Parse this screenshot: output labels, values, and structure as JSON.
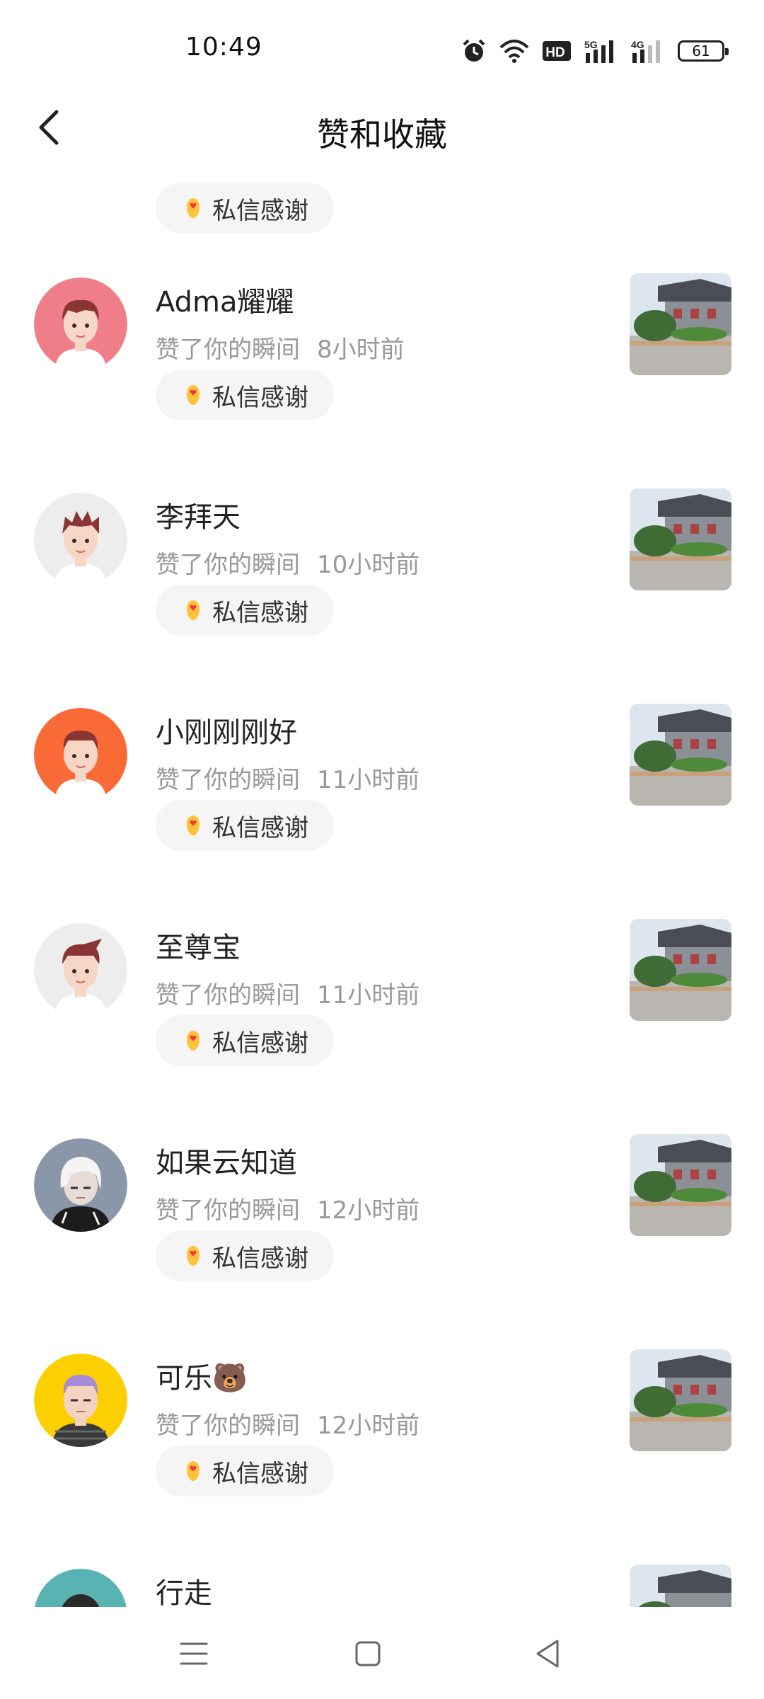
{
  "status_bar": {
    "time": "10:49",
    "icons": [
      "alarm-icon",
      "wifi-icon",
      "hd-icon",
      "signal-5g-icon",
      "signal-4g-icon"
    ],
    "hd_label": "HD",
    "net_5g_label": "5G",
    "net_4g_label": "4G",
    "battery_level": "61"
  },
  "header": {
    "title": "赞和收藏"
  },
  "top_partial": {
    "thank_label": "私信感谢"
  },
  "items": [
    {
      "name": "Adma耀耀",
      "action": "赞了你的瞬间",
      "time": "8小时前",
      "thank_label": "私信感谢",
      "avatar_bg": "#f07e89"
    },
    {
      "name": "李拜天",
      "action": "赞了你的瞬间",
      "time": "10小时前",
      "thank_label": "私信感谢",
      "avatar_bg": "#ededed"
    },
    {
      "name": "小刚刚刚好",
      "action": "赞了你的瞬间",
      "time": "11小时前",
      "thank_label": "私信感谢",
      "avatar_bg": "#fa6a36"
    },
    {
      "name": "至尊宝",
      "action": "赞了你的瞬间",
      "time": "11小时前",
      "thank_label": "私信感谢",
      "avatar_bg": "#ededed"
    },
    {
      "name": "如果云知道",
      "action": "赞了你的瞬间",
      "time": "12小时前",
      "thank_label": "私信感谢",
      "avatar_bg": "#8a97a8"
    },
    {
      "name": "可乐🐻",
      "action": "赞了你的瞬间",
      "time": "12小时前",
      "thank_label": "私信感谢",
      "avatar_bg": "#fcd000"
    },
    {
      "name": "行走",
      "avatar_bg": "#5ab3b3"
    }
  ],
  "nav_bar": {
    "icons": [
      "menu-icon",
      "home-icon",
      "back-icon"
    ]
  },
  "colors": {
    "background": "#ffffff",
    "text_primary": "#222222",
    "text_secondary": "#999999",
    "button_bg": "#f5f5f5"
  }
}
